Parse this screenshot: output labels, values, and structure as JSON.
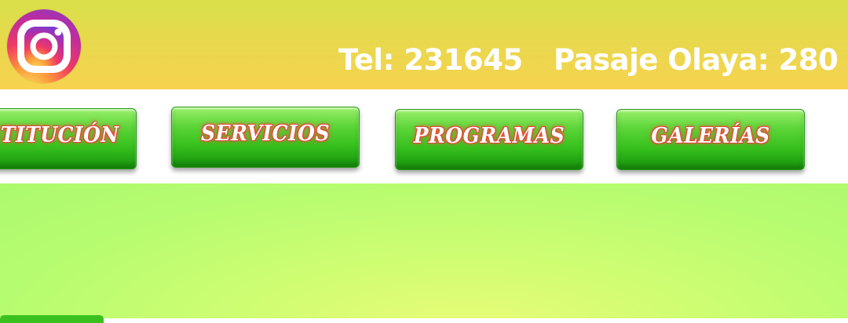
{
  "header": {
    "social_icon": "instagram-icon",
    "phone": "Tel: 231645",
    "address": "Pasaje Olaya: 280"
  },
  "nav": {
    "items": [
      {
        "label": "STITUCIÓN"
      },
      {
        "label": "SERVICIOS"
      },
      {
        "label": "PROGRAMAS"
      },
      {
        "label": "GALERÍAS"
      }
    ]
  },
  "colors": {
    "header_gradient_top": "#d8e04a",
    "header_gradient_bottom": "#f7d24f",
    "nav_background": "#ffffff",
    "button_green": "#39c21f",
    "label_glow": "#e8503a",
    "main_background": "#b7fc70"
  }
}
